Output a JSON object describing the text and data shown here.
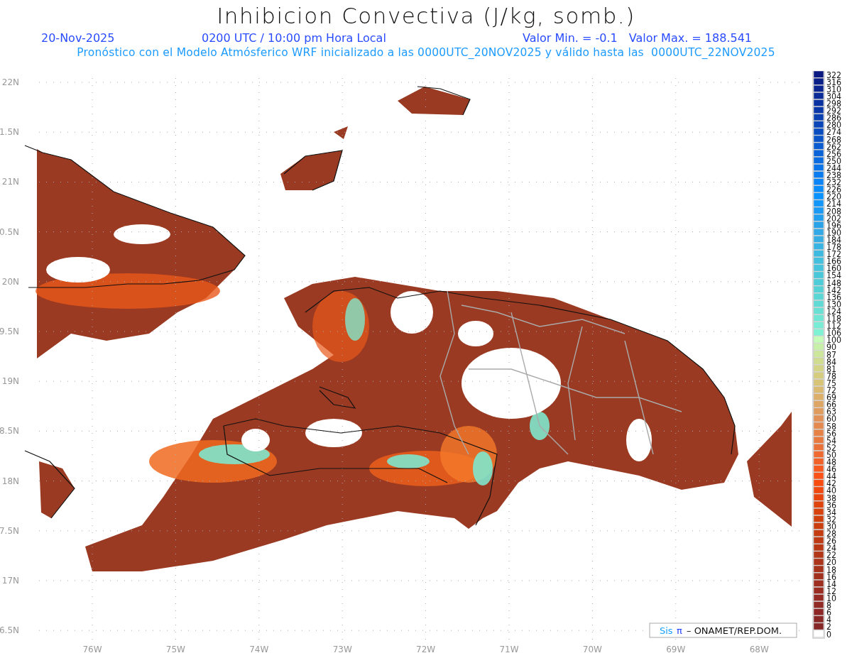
{
  "title": "Inhibicion Convectiva (J/kg, somb.)",
  "info": {
    "date": "20-Nov-2025",
    "time": "0200 UTC / 10:00 pm Hora Local",
    "min": "Valor Min. = -0.1",
    "max": "Valor Max. = 188.541"
  },
  "description": "Pronóstico con el Modelo Atmósferico WRF inicializado a las 0000UTC_20NOV2025 y válido hasta las  0000UTC_22NOV2025",
  "map": {
    "lat_labels": [
      "22N",
      "1.5N",
      "21N",
      "0.5N",
      "20N",
      "9.5N",
      "19N",
      "8.5N",
      "18N",
      "7.5N",
      "17N",
      "6.5N"
    ],
    "lon_labels": [
      "76W",
      "75W",
      "74W",
      "73W",
      "72W",
      "71W",
      "70W",
      "69W",
      "68W"
    ],
    "credit": {
      "logo_text": "Sis",
      "logo_symbol": "π",
      "text": "– ONAMET/REP.DOM."
    }
  },
  "colorbar": [
    {
      "label": "322",
      "color": "#0a1a80"
    },
    {
      "label": "316",
      "color": "#0a1f88"
    },
    {
      "label": "310",
      "color": "#0a2590"
    },
    {
      "label": "304",
      "color": "#0a2b98"
    },
    {
      "label": "298",
      "color": "#0a32a0"
    },
    {
      "label": "292",
      "color": "#0a38a8"
    },
    {
      "label": "286",
      "color": "#0a3fb0"
    },
    {
      "label": "280",
      "color": "#0a46b8"
    },
    {
      "label": "274",
      "color": "#0a4dc0"
    },
    {
      "label": "268",
      "color": "#0a54c8"
    },
    {
      "label": "262",
      "color": "#0a5cd0"
    },
    {
      "label": "256",
      "color": "#0a64d8"
    },
    {
      "label": "250",
      "color": "#0a6ce0"
    },
    {
      "label": "244",
      "color": "#0a74e8"
    },
    {
      "label": "238",
      "color": "#0a7cf0"
    },
    {
      "label": "232",
      "color": "#0a84f6"
    },
    {
      "label": "226",
      "color": "#0a8cfa"
    },
    {
      "label": "220",
      "color": "#0a92ff"
    },
    {
      "label": "214",
      "color": "#1296fa"
    },
    {
      "label": "208",
      "color": "#1a9af4"
    },
    {
      "label": "202",
      "color": "#229eee"
    },
    {
      "label": "196",
      "color": "#2aa2e8"
    },
    {
      "label": "190",
      "color": "#32a8e6"
    },
    {
      "label": "184",
      "color": "#36aee4"
    },
    {
      "label": "178",
      "color": "#3ab4e2"
    },
    {
      "label": "172",
      "color": "#3ebae0"
    },
    {
      "label": "166",
      "color": "#42c0de"
    },
    {
      "label": "160",
      "color": "#46c4dc"
    },
    {
      "label": "154",
      "color": "#4ac8da"
    },
    {
      "label": "148",
      "color": "#4ecdd8"
    },
    {
      "label": "142",
      "color": "#54d2d6"
    },
    {
      "label": "136",
      "color": "#5ad6d4"
    },
    {
      "label": "130",
      "color": "#60dad4"
    },
    {
      "label": "124",
      "color": "#68e0d4"
    },
    {
      "label": "118",
      "color": "#70e6d4"
    },
    {
      "label": "112",
      "color": "#78ecd4"
    },
    {
      "label": "106",
      "color": "#80f2d4"
    },
    {
      "label": "100",
      "color": "#c4fcb8"
    },
    {
      "label": "90",
      "color": "#c8f0a8"
    },
    {
      "label": "87",
      "color": "#cce69c"
    },
    {
      "label": "84",
      "color": "#d0dc90"
    },
    {
      "label": "81",
      "color": "#d4d486"
    },
    {
      "label": "78",
      "color": "#d6cc7e"
    },
    {
      "label": "75",
      "color": "#d8c476"
    },
    {
      "label": "72",
      "color": "#daba70"
    },
    {
      "label": "69",
      "color": "#dcb06a"
    },
    {
      "label": "66",
      "color": "#dea664"
    },
    {
      "label": "63",
      "color": "#e09c5e"
    },
    {
      "label": "60",
      "color": "#e29258"
    },
    {
      "label": "58",
      "color": "#e48a50"
    },
    {
      "label": "56",
      "color": "#e68248"
    },
    {
      "label": "54",
      "color": "#e87a40"
    },
    {
      "label": "52",
      "color": "#ea7238"
    },
    {
      "label": "50",
      "color": "#ee6a30"
    },
    {
      "label": "48",
      "color": "#f26228"
    },
    {
      "label": "46",
      "color": "#f65a20"
    },
    {
      "label": "44",
      "color": "#fa5218"
    },
    {
      "label": "42",
      "color": "#f84c10"
    },
    {
      "label": "40",
      "color": "#f0480e"
    },
    {
      "label": "38",
      "color": "#e8460e"
    },
    {
      "label": "36",
      "color": "#e0440e"
    },
    {
      "label": "34",
      "color": "#d8420e"
    },
    {
      "label": "32",
      "color": "#d0400e"
    },
    {
      "label": "30",
      "color": "#ca3e10"
    },
    {
      "label": "28",
      "color": "#c43c12"
    },
    {
      "label": "26",
      "color": "#be3a14"
    },
    {
      "label": "24",
      "color": "#b83816"
    },
    {
      "label": "22",
      "color": "#b23618"
    },
    {
      "label": "20",
      "color": "#ac341a"
    },
    {
      "label": "18",
      "color": "#a6321c"
    },
    {
      "label": "16",
      "color": "#a2301e"
    },
    {
      "label": "14",
      "color": "#9e2e20"
    },
    {
      "label": "12",
      "color": "#9a2c22"
    },
    {
      "label": "10",
      "color": "#962a24"
    },
    {
      "label": "8",
      "color": "#922a26"
    },
    {
      "label": "6",
      "color": "#8e2828"
    },
    {
      "label": "4",
      "color": "#8a2828"
    },
    {
      "label": "2",
      "color": "#862828"
    },
    {
      "label": "0",
      "color": "#ffffff"
    }
  ]
}
